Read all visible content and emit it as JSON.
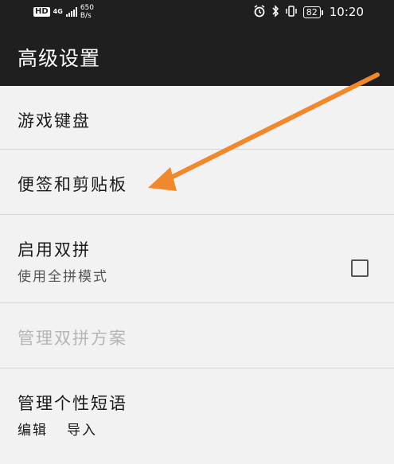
{
  "status_bar": {
    "hd_badge": "HD",
    "network_gen": "4G",
    "speed_value": "650",
    "speed_unit": "B/s",
    "icons": [
      "alarm-icon",
      "bluetooth-icon",
      "vibrate-icon"
    ],
    "battery": "82",
    "time": "10:20"
  },
  "app_bar": {
    "title": "高级设置"
  },
  "settings": {
    "game_keyboard": "游戏键盘",
    "notes_clipboard": "便签和剪贴板",
    "double_pinyin": {
      "title": "启用双拼",
      "subtitle": "使用全拼模式",
      "checked": false
    },
    "manage_double_pinyin": "管理双拼方案",
    "personal_phrases": {
      "title": "管理个性短语",
      "action_edit": "编辑",
      "action_import": "导入"
    }
  },
  "annotation": {
    "arrow_color": "#f0892d"
  }
}
